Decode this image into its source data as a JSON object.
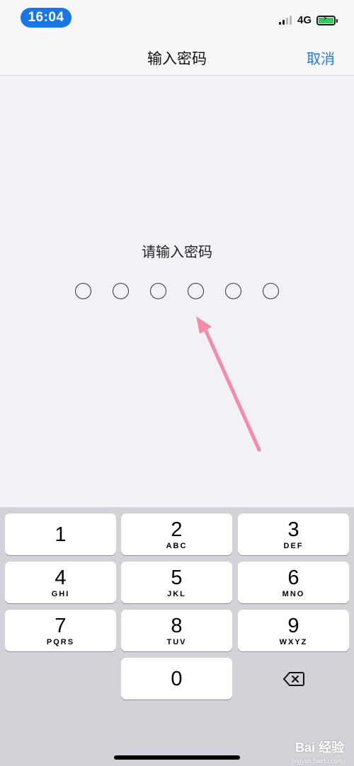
{
  "status_bar": {
    "time": "16:04",
    "network": "4G",
    "signal_icon": "signal-bars-icon",
    "battery_icon": "battery-charging-icon",
    "battery_color": "#35c759"
  },
  "nav_bar": {
    "title": "输入密码",
    "cancel_label": "取消",
    "accent_color": "#1a7fe3"
  },
  "passcode": {
    "prompt": "请输入密码",
    "digit_count": 6,
    "filled": 0
  },
  "keypad": {
    "keys": [
      {
        "num": "1",
        "letters": ""
      },
      {
        "num": "2",
        "letters": "ABC"
      },
      {
        "num": "3",
        "letters": "DEF"
      },
      {
        "num": "4",
        "letters": "GHI"
      },
      {
        "num": "5",
        "letters": "JKL"
      },
      {
        "num": "6",
        "letters": "MNO"
      },
      {
        "num": "7",
        "letters": "PQRS"
      },
      {
        "num": "8",
        "letters": "TUV"
      },
      {
        "num": "9",
        "letters": "WXYZ"
      },
      {
        "num": "0",
        "letters": ""
      }
    ],
    "delete_icon": "backspace-icon"
  },
  "annotation": {
    "arrow_color": "#f48ca6"
  },
  "watermark": {
    "brand": "Bai 经验",
    "url": "jingyan.baidu.com"
  }
}
